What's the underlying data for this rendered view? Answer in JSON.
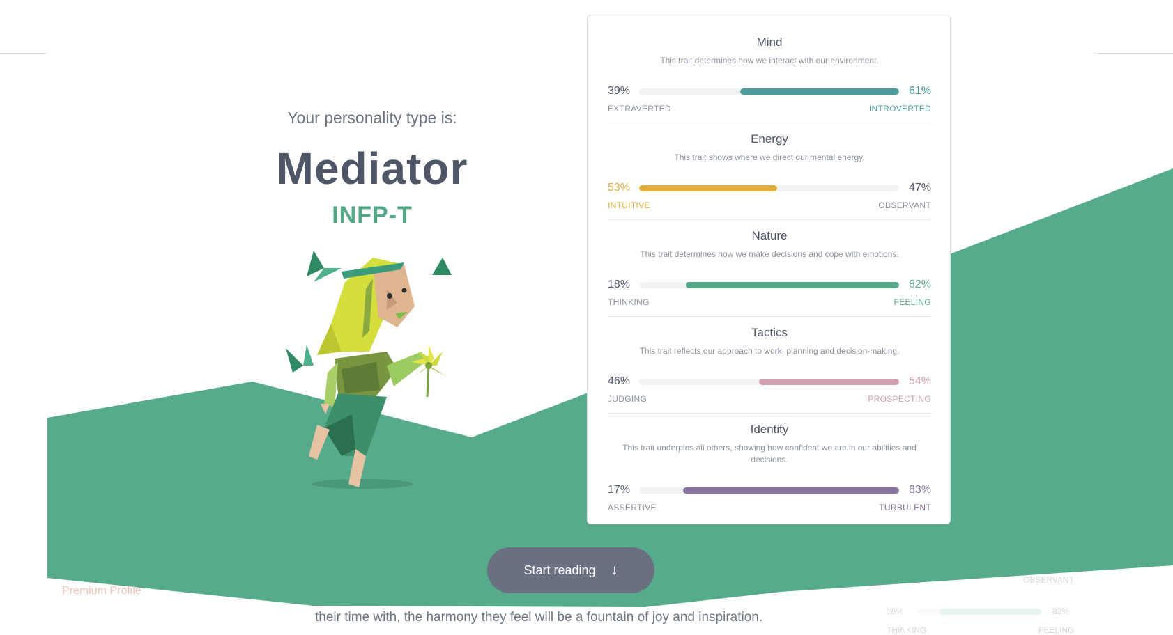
{
  "intro": {
    "label": "Your personality type is:",
    "type_name": "Mediator",
    "type_code": "INFP-T"
  },
  "traits": [
    {
      "title": "Mind",
      "description": "This trait determines how we interact with our environment.",
      "left_pct": "39%",
      "right_pct": "61%",
      "left_label": "EXTRAVERTED",
      "right_label": "INTROVERTED",
      "dominant": "right",
      "dominant_value": 0.61,
      "color": "#4a9d9c"
    },
    {
      "title": "Energy",
      "description": "This trait shows where we direct our mental energy.",
      "left_pct": "53%",
      "right_pct": "47%",
      "left_label": "INTUITIVE",
      "right_label": "OBSERVANT",
      "dominant": "left",
      "dominant_value": 0.53,
      "color": "#e4ae3a"
    },
    {
      "title": "Nature",
      "description": "This trait determines how we make decisions and cope with emotions.",
      "left_pct": "18%",
      "right_pct": "82%",
      "left_label": "THINKING",
      "right_label": "FEELING",
      "dominant": "right",
      "dominant_value": 0.82,
      "color": "#56a988"
    },
    {
      "title": "Tactics",
      "description": "This trait reflects our approach to work, planning and decision-making.",
      "left_pct": "46%",
      "right_pct": "54%",
      "left_label": "JUDGING",
      "right_label": "PROSPECTING",
      "dominant": "right",
      "dominant_value": 0.54,
      "color": "#d19fb2"
    },
    {
      "title": "Identity",
      "description": "This trait underpins all others, showing how confident we are in our abilities and decisions.",
      "left_pct": "17%",
      "right_pct": "83%",
      "left_label": "ASSERTIVE",
      "right_label": "TURBULENT",
      "dominant": "right",
      "dominant_value": 0.83,
      "color": "#88729e"
    }
  ],
  "cta": {
    "label": "Start reading",
    "icon": "arrow-down-icon"
  },
  "below": {
    "premium_label": "Premium Profile",
    "body_text": "their time with, the harmony they feel will be a fountain of joy and inspiration.",
    "ghost_pct_left": "18%",
    "ghost_pct_right": "82%",
    "ghost_label_top": "OBSERVANT",
    "ghost_label_left": "THINKING",
    "ghost_label_right": "FEELING"
  },
  "colors": {
    "green": "#56ab8a",
    "title": "#4e5667",
    "button": "#6a7081"
  }
}
